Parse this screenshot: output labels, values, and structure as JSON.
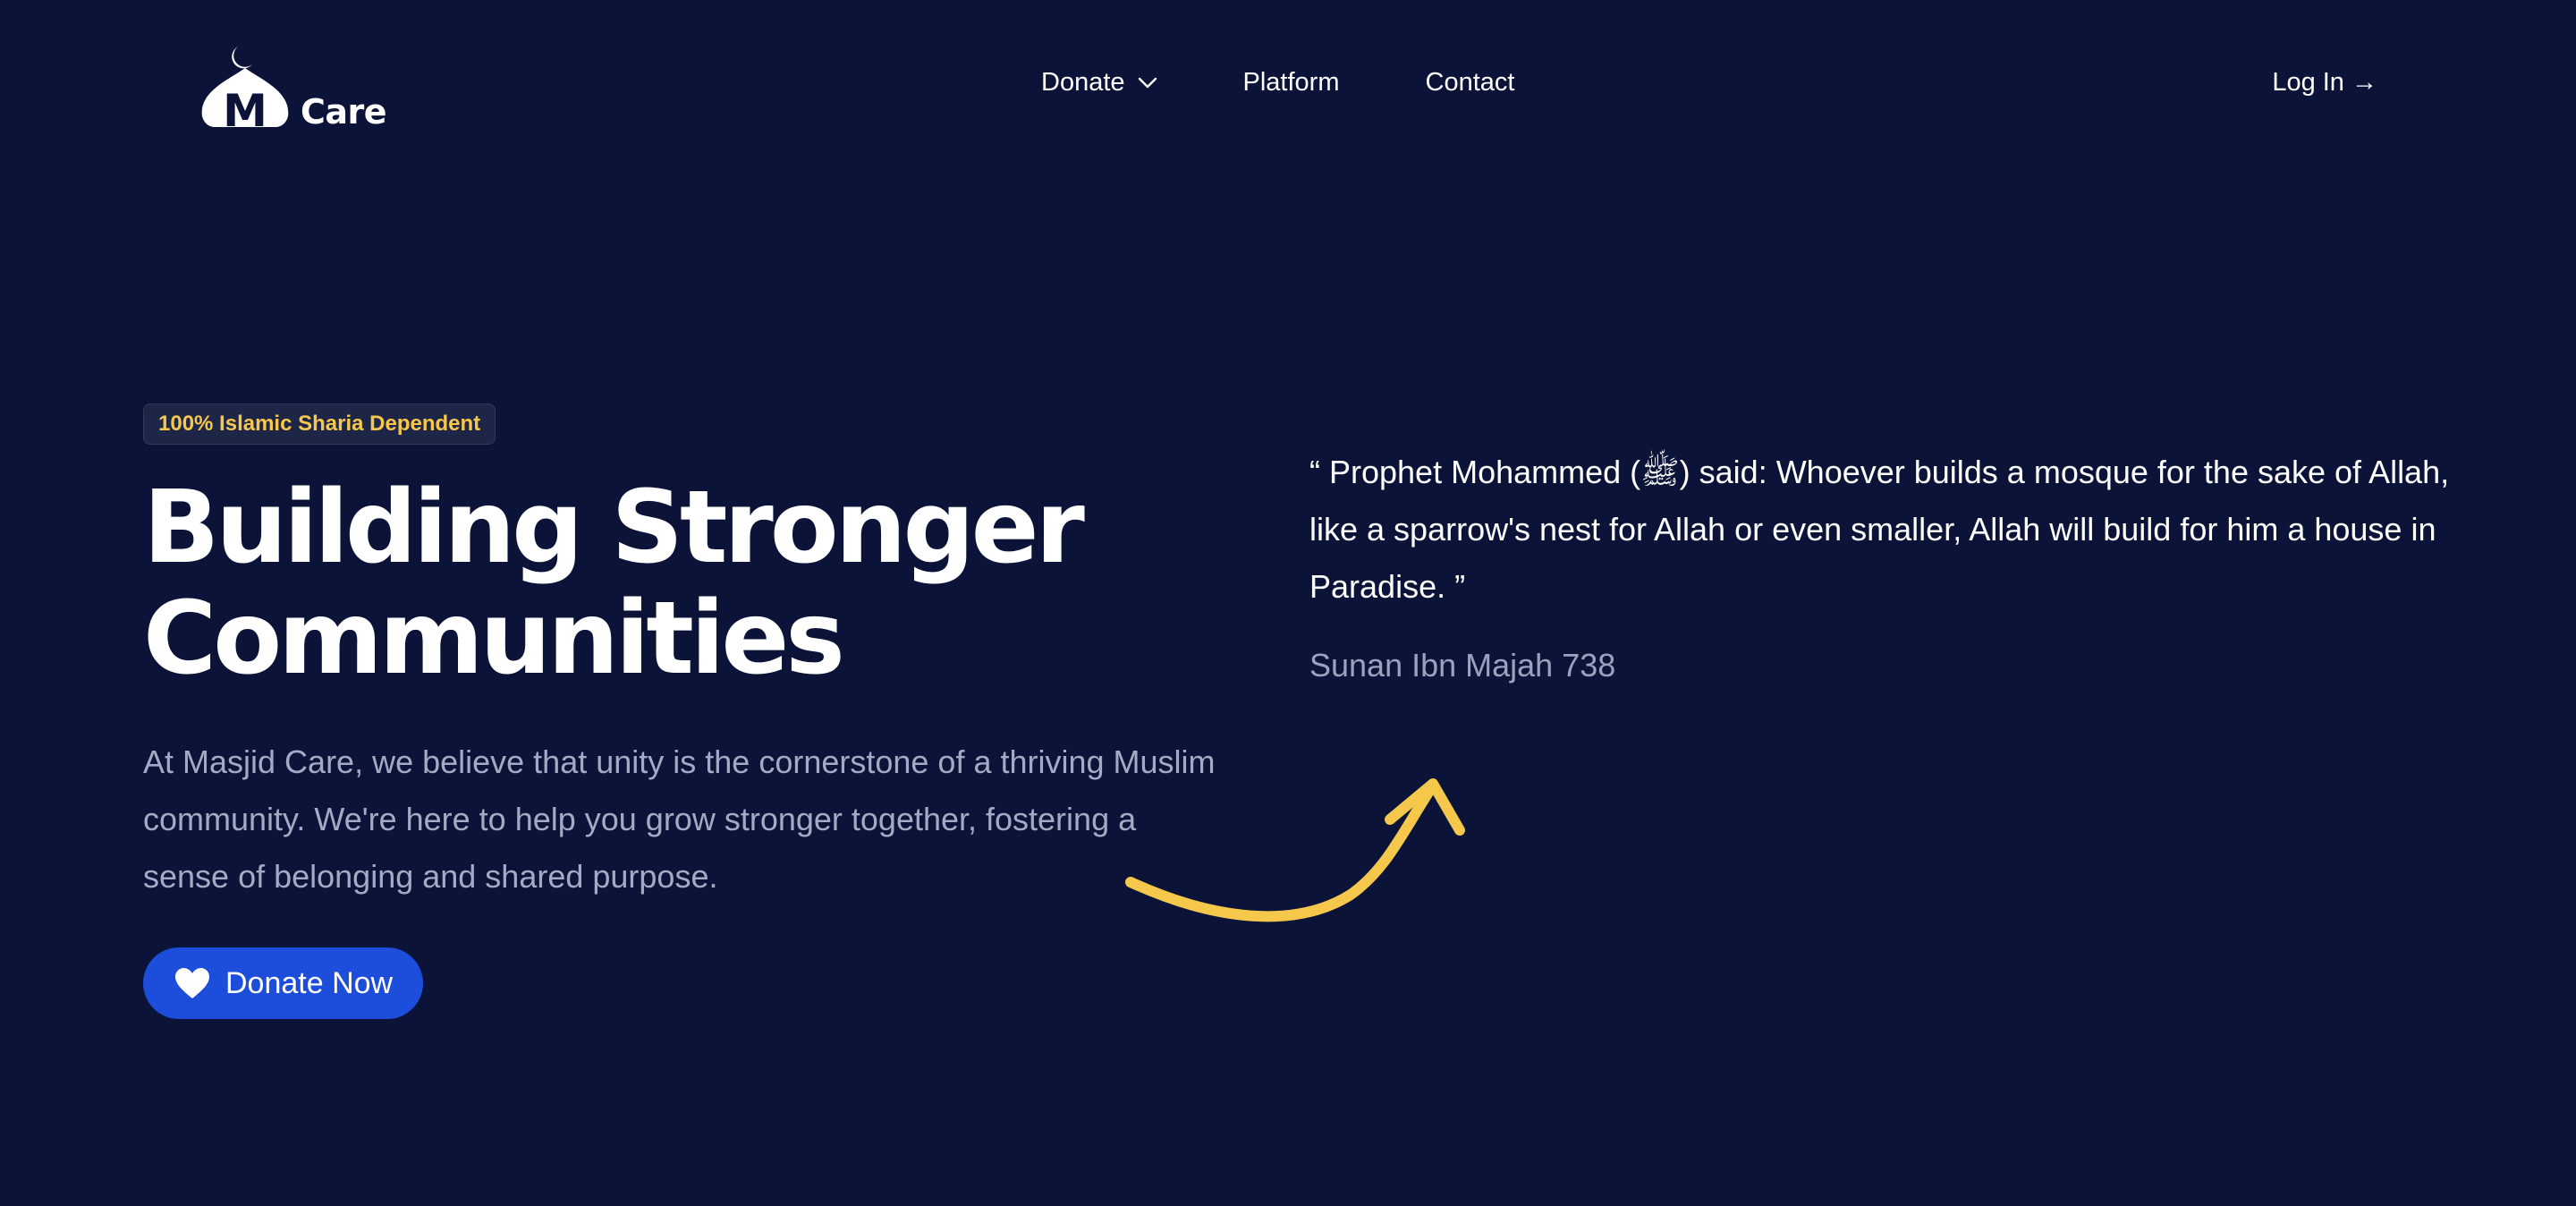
{
  "header": {
    "logo_text": "Care",
    "logo_letter": "M",
    "nav": [
      {
        "label": "Donate",
        "has_dropdown": true
      },
      {
        "label": "Platform"
      },
      {
        "label": "Contact"
      }
    ],
    "login_label": "Log In →"
  },
  "hero": {
    "badge": "100% Islamic Sharia Dependent",
    "headline_line1": "Building Stronger",
    "headline_line2": "Communities",
    "description": "At Masjid Care, we believe that unity is the cornerstone of a thriving Muslim community. We're here to help you grow stronger together, fostering a sense of belonging and shared purpose.",
    "cta_label": "Donate Now"
  },
  "quote": {
    "text": "“ Prophet Mohammed (ﷺ) said: Whoever builds a mosque for the sake of Allah, like a sparrow's nest for Allah or even smaller, Allah will build for him a house in Paradise. ”",
    "source": "Sunan Ibn Majah 738"
  },
  "icons": {
    "logo": "mosque-dome-icon",
    "dropdown": "chevron-down-icon",
    "donate": "heart-icon",
    "decoration": "curved-arrow-icon"
  },
  "colors": {
    "background": "#0b1438",
    "badge_text": "#f7c74b",
    "button": "#1c4ddb",
    "arrow": "#f5c84c",
    "muted_text": "#a3abc4"
  }
}
